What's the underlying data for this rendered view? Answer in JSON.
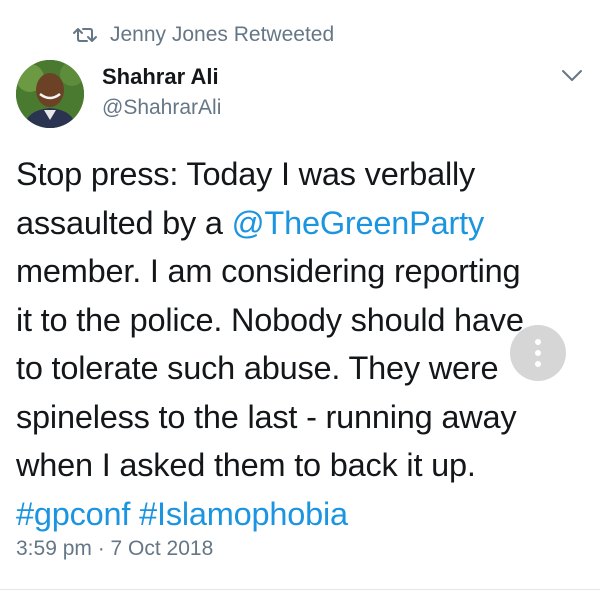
{
  "retweet": {
    "icon": "retweet-icon",
    "label": "Jenny Jones Retweeted"
  },
  "author": {
    "avatar": "avatar",
    "name": "Shahrar Ali",
    "handle": "@ShahrarAli"
  },
  "tweet": {
    "lines": [
      [
        "Stop press: Today I was verbally"
      ],
      [
        "assaulted by a ",
        "@TheGreenParty"
      ],
      [
        "member. I am considering reporting"
      ],
      [
        "it to the police. Nobody should have"
      ],
      [
        "to tolerate such abuse. They were"
      ],
      [
        "spineless to the last - running away"
      ],
      [
        "when I asked them to back it up."
      ],
      [
        "#gpconf",
        " ",
        "#Islamophobia"
      ]
    ],
    "mention": "@TheGreenParty",
    "hashtags": [
      "#gpconf",
      "#Islamophobia"
    ]
  },
  "timestamp": "3:59 pm · 7 Oct 2018",
  "colors": {
    "link": "#1b95e0",
    "secondary_text": "#657786",
    "primary_text": "#14171a"
  }
}
